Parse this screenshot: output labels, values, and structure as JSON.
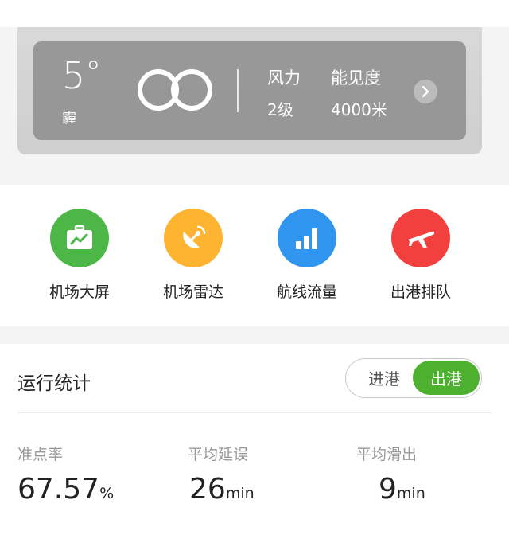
{
  "weather": {
    "temperature": "5",
    "degree": "°",
    "condition": "霾",
    "wind_label": "风力",
    "wind_value": "2级",
    "visibility_label": "能见度",
    "visibility_value": "4000米"
  },
  "quick_access": [
    {
      "label": "机场大屏",
      "icon": "airport-screen-icon",
      "color": "#4cb747"
    },
    {
      "label": "机场雷达",
      "icon": "radar-icon",
      "color": "#ffb431"
    },
    {
      "label": "航线流量",
      "icon": "bar-chart-icon",
      "color": "#2f95ef"
    },
    {
      "label": "出港排队",
      "icon": "departure-plane-icon",
      "color": "#f2403f"
    }
  ],
  "stats": {
    "title": "运行统计",
    "toggle": {
      "arrival": "进港",
      "departure": "出港",
      "selected": "出港"
    },
    "metrics": [
      {
        "label": "准点率",
        "value": "67.57",
        "unit": "%"
      },
      {
        "label": "平均延误",
        "value": "26",
        "unit": "min"
      },
      {
        "label": "平均滑出",
        "value": "9",
        "unit": "min"
      }
    ]
  },
  "colors": {
    "accent_green": "#4db02f"
  }
}
